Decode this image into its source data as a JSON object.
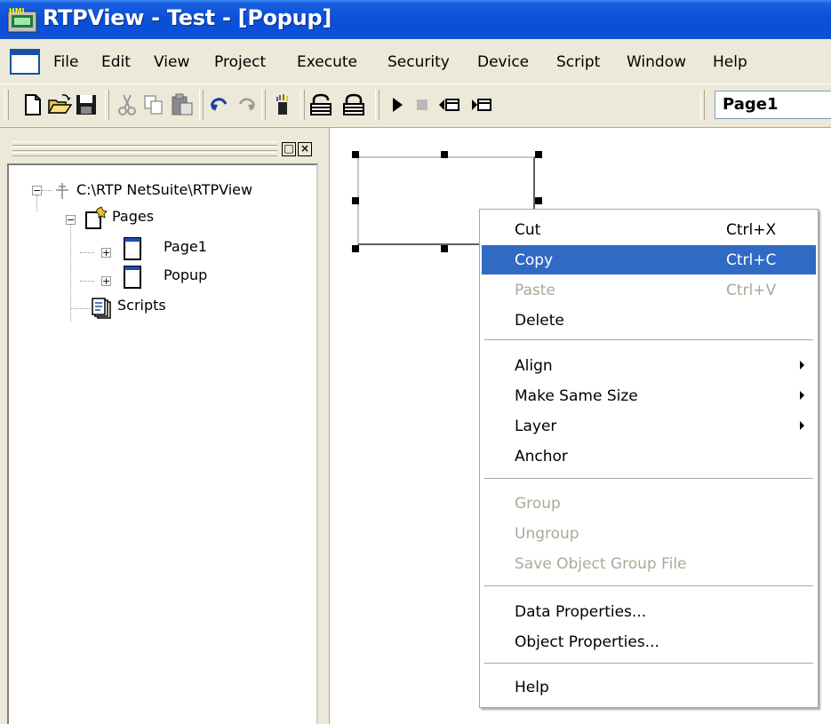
{
  "window": {
    "title": "RTPView  -  Test - [Popup]",
    "title_bar_color": "#0a4fd6"
  },
  "menubar": {
    "items": [
      "File",
      "Edit",
      "View",
      "Project",
      "Execute",
      "Security",
      "Device",
      "Script",
      "Window",
      "Help"
    ]
  },
  "toolbar": {
    "buttons": [
      "new-file-icon",
      "open-folder-icon",
      "save-icon",
      "cut-icon",
      "copy-icon",
      "paste-icon",
      "undo-icon",
      "redo-icon",
      "wand-icon",
      "lock-open-icon",
      "lock-icon",
      "play-icon",
      "stop-icon",
      "prev-page-icon",
      "next-page-icon"
    ],
    "page_select": "Page1"
  },
  "panel": {
    "float_button": "□",
    "close_button": "×"
  },
  "tree": {
    "root": "C:\\RTP NetSuite\\RTPView",
    "pages": "Pages",
    "page1": "Page1",
    "popup": "Popup",
    "scripts": "Scripts"
  },
  "context_menu": {
    "highlight_color": "#316ac5",
    "disabled_color": "#aca899",
    "cut": "Cut",
    "cut_shortcut": "Ctrl+X",
    "copy": "Copy",
    "copy_shortcut": "Ctrl+C",
    "paste": "Paste",
    "paste_shortcut": "Ctrl+V",
    "delete": "Delete",
    "align": "Align",
    "make_same_size": "Make Same Size",
    "layer": "Layer",
    "anchor": "Anchor",
    "group": "Group",
    "ungroup": "Ungroup",
    "save_group": "Save Object Group File",
    "data_properties": "Data Properties...",
    "object_properties": "Object Properties...",
    "help": "Help"
  }
}
